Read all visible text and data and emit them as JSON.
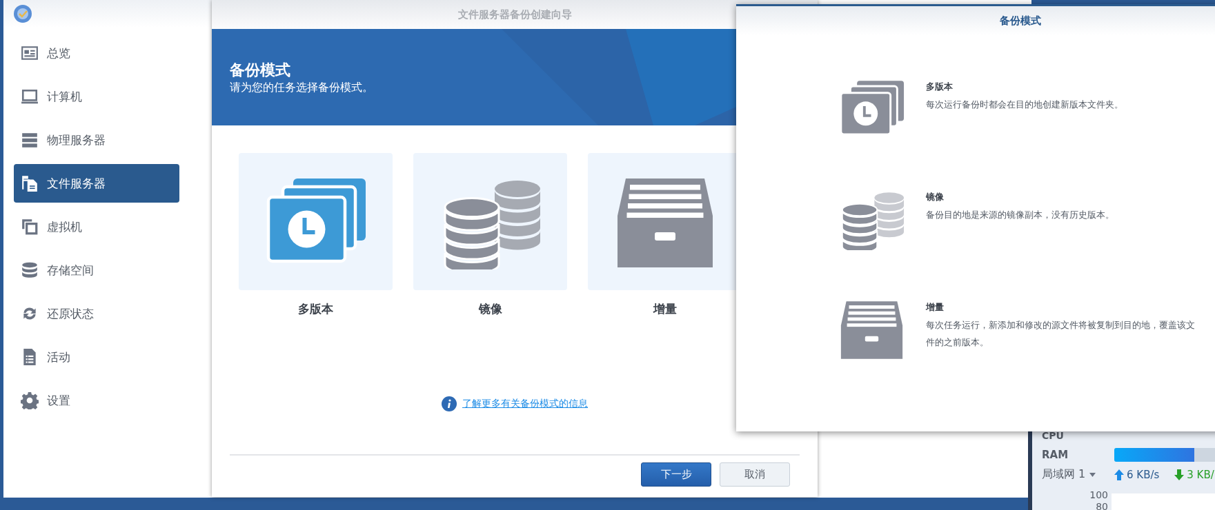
{
  "app": {
    "sidebar": {
      "items": [
        {
          "label": "总览",
          "kind": "overview",
          "selected": false
        },
        {
          "label": "计算机",
          "kind": "computer",
          "selected": false
        },
        {
          "label": "物理服务器",
          "kind": "server",
          "selected": false
        },
        {
          "label": "文件服务器",
          "kind": "file",
          "selected": true
        },
        {
          "label": "虚拟机",
          "kind": "vm",
          "selected": false
        },
        {
          "label": "存储空间",
          "kind": "storage",
          "selected": false
        },
        {
          "label": "还原状态",
          "kind": "restore",
          "selected": false
        },
        {
          "label": "活动",
          "kind": "activity",
          "selected": false
        },
        {
          "label": "设置",
          "kind": "settings",
          "selected": false
        }
      ]
    }
  },
  "wizard": {
    "title": "文件服务器备份创建向导",
    "banner": {
      "title": "备份模式",
      "subtitle": "请为您的任务选择备份模式。"
    },
    "modes": [
      {
        "label": "多版本",
        "kind": "versions"
      },
      {
        "label": "镜像",
        "kind": "mirror"
      },
      {
        "label": "增量",
        "kind": "incremental"
      }
    ],
    "info_link": "了解更多有关备份模式的信息",
    "buttons": [
      {
        "label": "下一步",
        "kind": "primary"
      },
      {
        "label": "取消",
        "kind": "secondary"
      }
    ]
  },
  "help_popup": {
    "title": "备份模式",
    "items": [
      {
        "title": "多版本",
        "description": "每次运行备份时都会在目的地创建新版本文件夹。",
        "kind": "versions"
      },
      {
        "title": "镜像",
        "description": "备份目的地是来源的镜像副本，没有历史版本。",
        "kind": "mirror"
      },
      {
        "title": "增量",
        "description": "每次任务运行，新添加和修改的源文件将被复制到目的地，覆盖该文件的之前版本。",
        "kind": "incremental"
      }
    ]
  },
  "resource_widget": {
    "cpu_label": "CPU",
    "ram_label": "RAM",
    "ram": {
      "level": 0.58
    },
    "network_label": "局域网 1",
    "upload": "6 KB/s",
    "download": "3 KB/",
    "ticks": [
      "100",
      "80"
    ]
  }
}
